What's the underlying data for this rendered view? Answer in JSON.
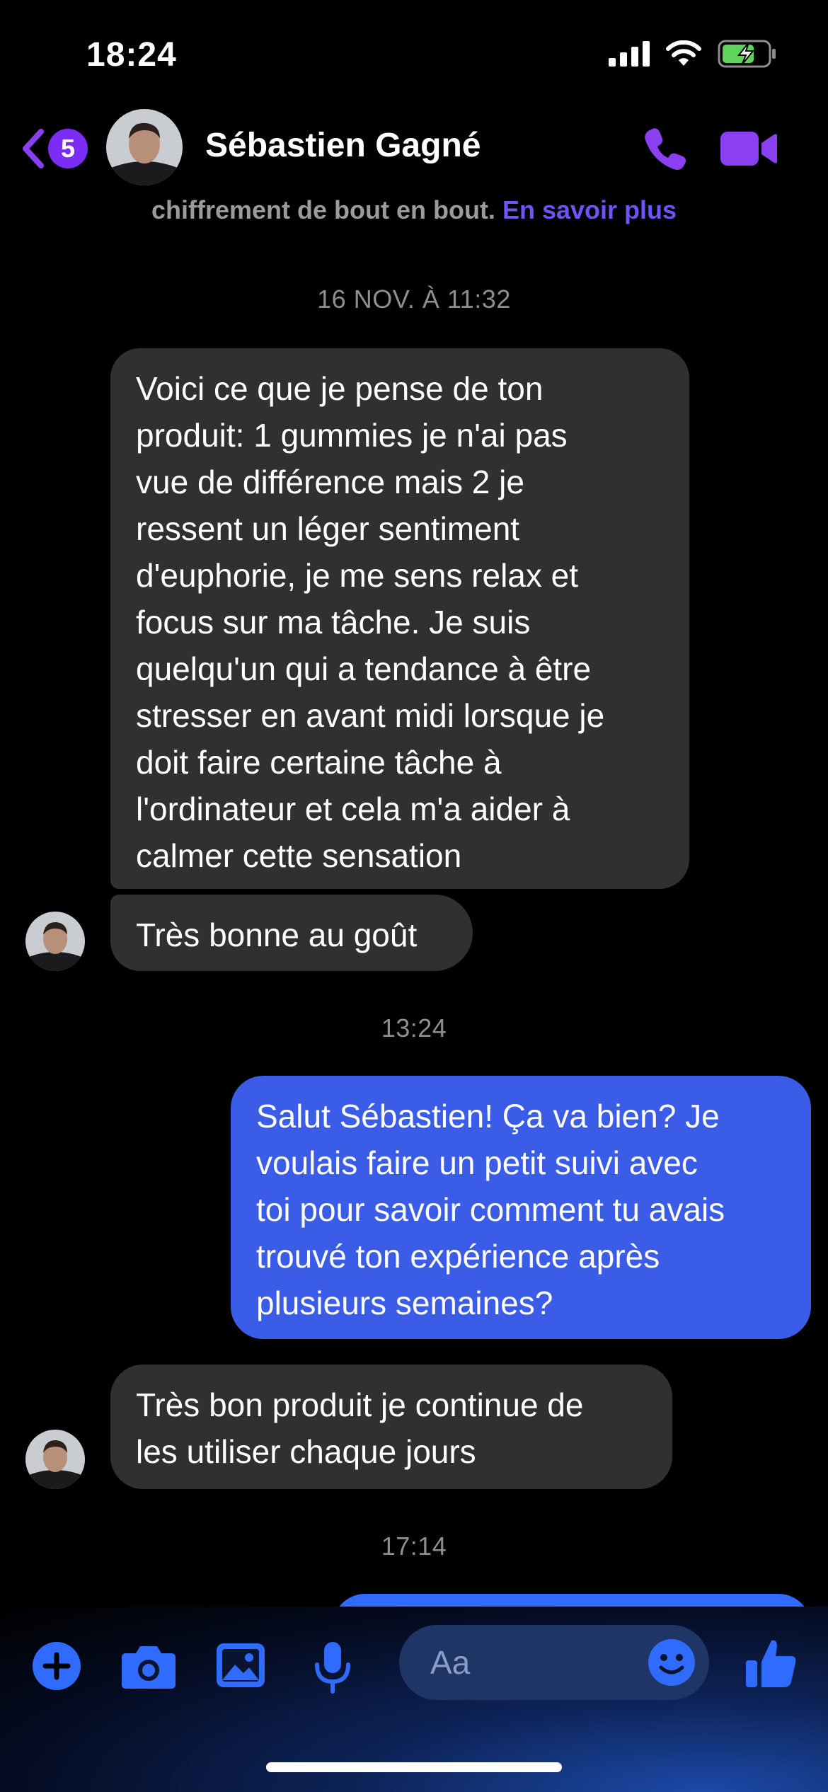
{
  "status_bar": {
    "time": "18:24",
    "battery_color": "#5fd35b"
  },
  "header": {
    "back_badge": "5",
    "contact_name": "Sébastien Gagné",
    "accent_color": "#8a3ff0",
    "icons": [
      "chevron-left-icon",
      "phone-icon",
      "video-camera-icon"
    ]
  },
  "encryption": {
    "text": "chiffrement de bout en bout.",
    "link": "En savoir plus"
  },
  "messages": {
    "ts1": "16 NOV. À 11:32",
    "m1": "Voici ce que je pense de ton\nproduit: 1 gummies je n'ai pas\nvue de différence mais 2 je\nressent un léger sentiment\nd'euphorie, je me sens relax et\nfocus sur ma tâche. Je suis\nquelqu'un qui a tendance à être\nstresser en avant midi lorsque je\ndoit faire certaine tâche à\nl'ordinateur et cela m'a aider à\ncalmer cette sensation",
    "m2": "Très bonne au goût",
    "ts2": "13:24",
    "m3": "Salut Sébastien! Ça va bien? Je\nvoulais faire un petit suivi avec\ntoi pour savoir comment tu avais\ntrouvé ton expérience après\nplusieurs semaines?",
    "m4": "Très bon produit je continue de\nles utiliser chaque jours",
    "ts3": "17:14"
  },
  "composer": {
    "placeholder": "Aa",
    "icons": [
      "plus-icon",
      "camera-icon",
      "photo-icon",
      "microphone-icon",
      "emoji-icon",
      "thumbs-up-icon"
    ],
    "accent_color": "#2f6bff"
  }
}
